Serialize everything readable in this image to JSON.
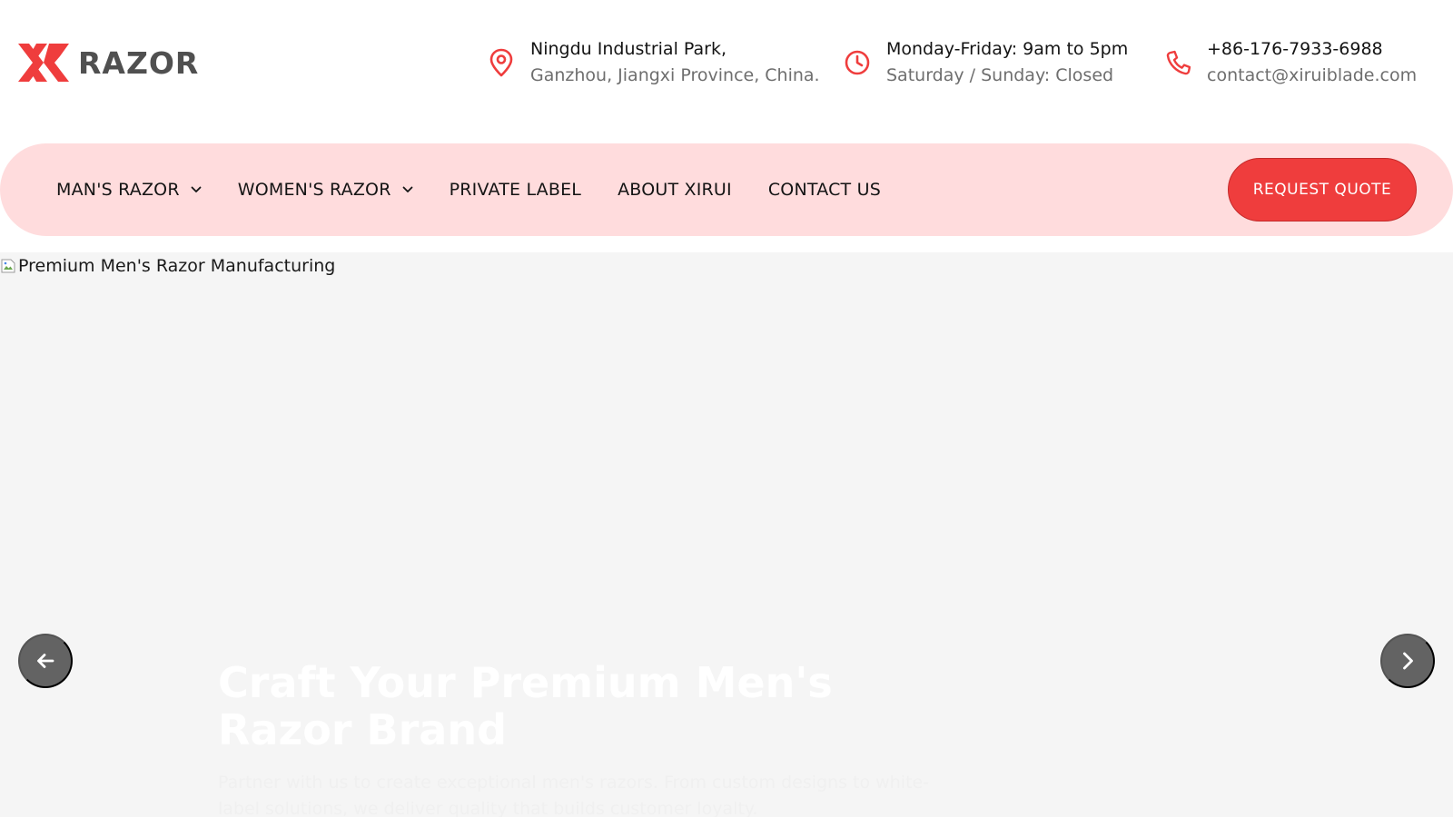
{
  "brand": {
    "logo_text": "RAZOR",
    "accent_color": "#ef3d3d",
    "logo_mark_icon": "xr-logo-icon"
  },
  "top_info": {
    "location": {
      "icon": "map-pin-icon",
      "line1": "Ningdu Industrial Park,",
      "line2": "Ganzhou, Jiangxi Province, China."
    },
    "hours": {
      "icon": "clock-icon",
      "line1": "Monday-Friday: 9am to 5pm",
      "line2": "Saturday / Sunday: Closed"
    },
    "contact": {
      "icon": "phone-icon",
      "line1": "+86-176-7933-6988",
      "line2": "contact@xiruiblade.com"
    }
  },
  "nav": {
    "background": "#ffdcdd",
    "items": [
      {
        "label": "MAN'S RAZOR",
        "has_dropdown": true
      },
      {
        "label": "WOMEN'S RAZOR",
        "has_dropdown": true
      },
      {
        "label": "PRIVATE LABEL",
        "has_dropdown": false
      },
      {
        "label": "ABOUT XIRUI",
        "has_dropdown": false
      },
      {
        "label": "CONTACT US",
        "has_dropdown": false
      }
    ],
    "cta_label": "REQUEST QUOTE"
  },
  "hero": {
    "image_alt": "Premium Men's Razor Manufacturing",
    "title": "Craft Your Premium Men's Razor Brand",
    "subtitle": "Partner with us to create exceptional men's razors. From custom designs to white-label solutions, we deliver quality that builds customer loyalty.",
    "prev_icon": "arrow-left-icon",
    "next_icon": "chevron-right-icon"
  }
}
